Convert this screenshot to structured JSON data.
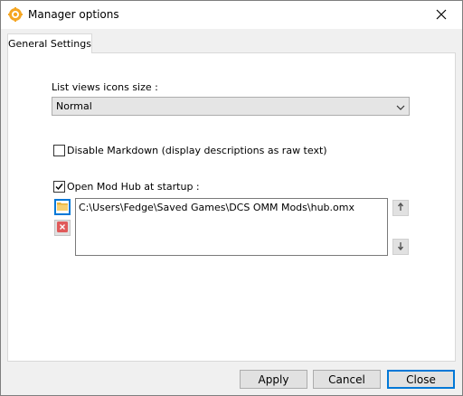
{
  "window": {
    "title": "Manager options",
    "close_icon": "close-icon",
    "app_icon": "gear-icon"
  },
  "tabs": [
    {
      "label": "General Settings",
      "selected": true
    }
  ],
  "general": {
    "icons_size_label": "List views icons size :",
    "icons_size_value": "Normal",
    "disable_markdown": {
      "label": "Disable Markdown (display descriptions as raw text)",
      "checked": false
    },
    "open_mod_hub": {
      "label": "Open Mod Hub at startup :",
      "checked": true
    },
    "hub_paths": [
      "C:\\Users\\Fedge\\Saved Games\\DCS OMM Mods\\hub.omx"
    ],
    "icons": {
      "browse": "folder-icon",
      "remove": "delete-icon",
      "up": "arrow-up-icon",
      "down": "arrow-down-icon"
    }
  },
  "footer": {
    "apply": "Apply",
    "cancel": "Cancel",
    "close": "Close"
  },
  "colors": {
    "accent": "#0078d7",
    "app_icon": "#f5a623",
    "delete": "#e05a5a"
  }
}
